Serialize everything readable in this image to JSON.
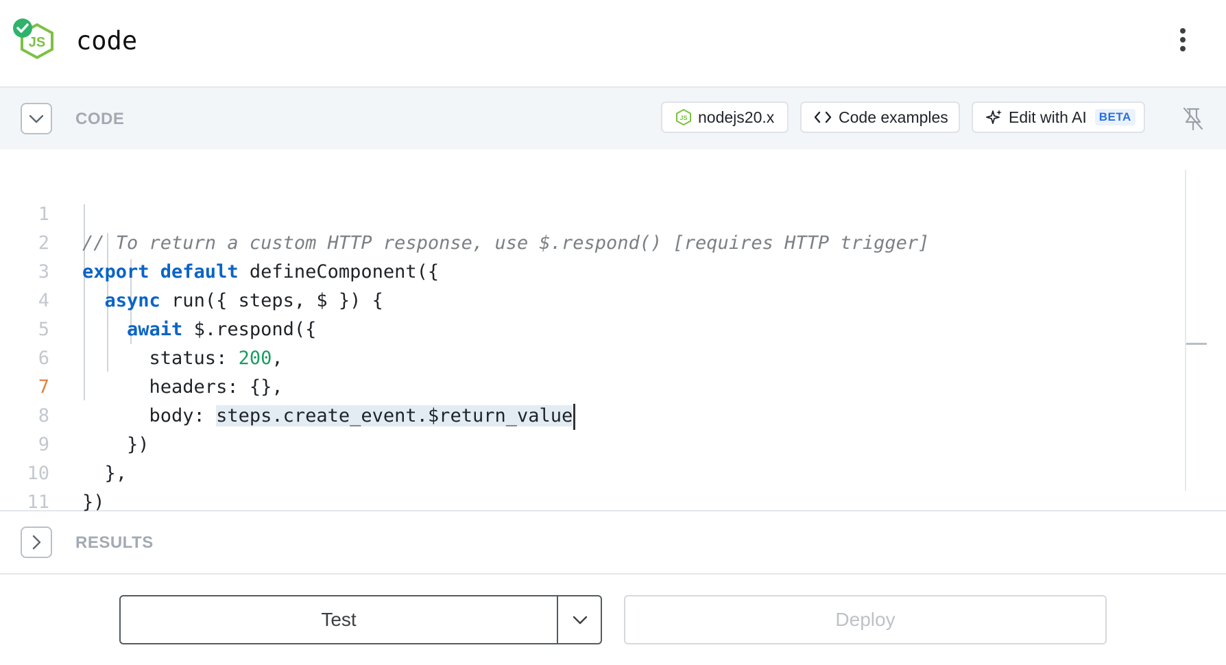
{
  "header": {
    "step_name": "code",
    "step_icon": "nodejs-icon",
    "status_icon": "check-circle-icon",
    "menu_icon": "kebab-menu-icon"
  },
  "code_section": {
    "label": "CODE",
    "runtime_label": "nodejs20.x",
    "code_examples_label": "Code examples",
    "edit_ai_label": "Edit with AI",
    "beta_badge": "BETA",
    "pin_icon": "pin-off-icon"
  },
  "editor": {
    "active_line": 7,
    "lines": [
      {
        "n": "1",
        "text": "// To return a custom HTTP response, use $.respond() [requires HTTP trigger]"
      },
      {
        "n": "2",
        "kw": "export default",
        "rest": " defineComponent({"
      },
      {
        "n": "3",
        "indent": "  ",
        "kw": "async",
        "rest": " run({ steps, $ }) {"
      },
      {
        "n": "4",
        "indent": "    ",
        "kw": "await",
        "rest": " $.respond({"
      },
      {
        "n": "5",
        "prefix": "      status: ",
        "num": "200",
        "suffix": ","
      },
      {
        "n": "6",
        "text": "      headers: {},"
      },
      {
        "n": "7",
        "prefix": "      body: ",
        "highlight": "steps.create_event.$return_value"
      },
      {
        "n": "8",
        "text": "    })"
      },
      {
        "n": "9",
        "text": "  },"
      },
      {
        "n": "10",
        "text": "})"
      },
      {
        "n": "11",
        "text": ""
      }
    ]
  },
  "results_section": {
    "label": "RESULTS"
  },
  "footer": {
    "test_label": "Test",
    "deploy_label": "Deploy"
  },
  "colors": {
    "keyword": "#0b64c5",
    "number": "#1a9d62",
    "comment": "#7b8085",
    "active_line_number": "#e0823d",
    "success": "#2fb36a"
  }
}
